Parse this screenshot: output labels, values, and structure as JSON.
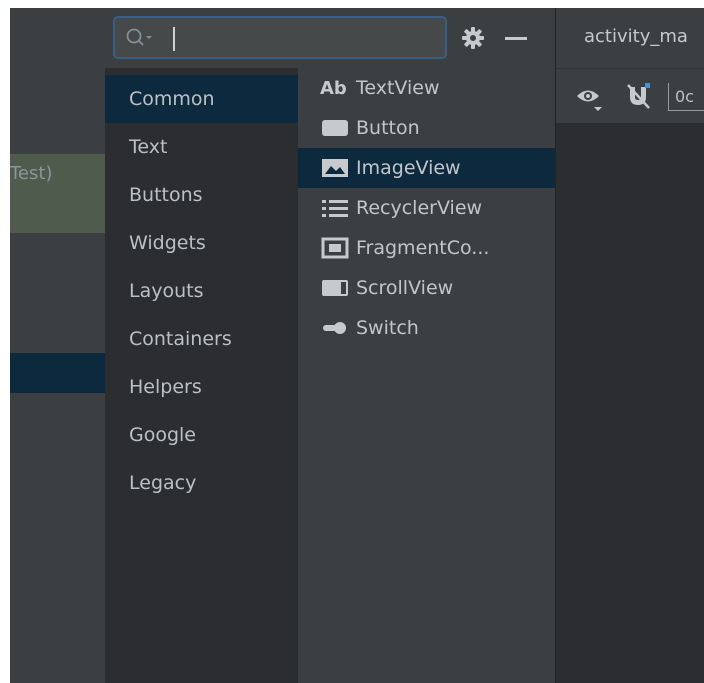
{
  "project_tree": {
    "item_label": "Test)"
  },
  "palette": {
    "search": {
      "value": "",
      "placeholder": ""
    },
    "categories": [
      {
        "label": "Common"
      },
      {
        "label": "Text"
      },
      {
        "label": "Buttons"
      },
      {
        "label": "Widgets"
      },
      {
        "label": "Layouts"
      },
      {
        "label": "Containers"
      },
      {
        "label": "Helpers"
      },
      {
        "label": "Google"
      },
      {
        "label": "Legacy"
      }
    ],
    "widgets": [
      {
        "label": "TextView",
        "icon": "textview-icon",
        "icon_text": "Ab"
      },
      {
        "label": "Button",
        "icon": "button-icon"
      },
      {
        "label": "ImageView",
        "icon": "imageview-icon"
      },
      {
        "label": "RecyclerView",
        "icon": "list-icon"
      },
      {
        "label": "FragmentCo...",
        "icon": "fragment-icon"
      },
      {
        "label": "ScrollView",
        "icon": "scrollview-icon"
      },
      {
        "label": "Switch",
        "icon": "switch-icon"
      }
    ]
  },
  "editor": {
    "tab_label": "activity_ma",
    "offset_value": "0c"
  },
  "colors": {
    "selection": "#0d293e",
    "panel": "#3c3f41",
    "background": "#2b2d30",
    "focus_border": "#3a5f87"
  }
}
